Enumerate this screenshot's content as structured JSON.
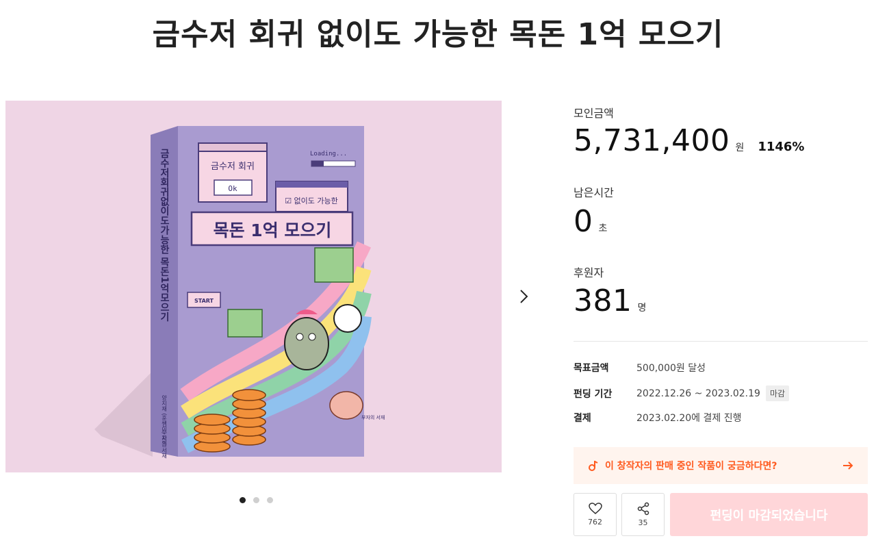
{
  "title": "금수저 회귀 없이도 가능한 목돈 1억 모으기",
  "gallery": {
    "book": {
      "spine_title": "금수저회귀없이도가능한 목돈1억모으기",
      "spine_author": "양지재 (훈쌤이) 지음",
      "spine_publisher": "부자의 서재",
      "popup1_title": "금수저 회귀",
      "popup1_button": "Ok",
      "loading_text": "Loading...",
      "popup2_text": "☑ 없이도 가능한",
      "main_title": "목돈 1억 모으기",
      "start_label": "START",
      "pig_text": "부자의 서재"
    },
    "dots_active": 0
  },
  "stats": {
    "raised_label": "모인금액",
    "raised_value": "5,731,400",
    "raised_unit": "원",
    "raised_percent": "1146%",
    "time_label": "남은시간",
    "time_value": "0",
    "time_unit": "초",
    "backers_label": "후원자",
    "backers_value": "381",
    "backers_unit": "명"
  },
  "info": {
    "goal_key": "목표금액",
    "goal_value": "500,000원 달성",
    "period_key": "펀딩 기간",
    "period_value": "2022.12.26 ~ 2023.02.19",
    "period_badge": "마감",
    "payment_key": "결제",
    "payment_value": "2023.02.20에 결제 진행"
  },
  "promo": {
    "text": "이 창작자의 판매 중인 작품이 궁금하다면?"
  },
  "actions": {
    "like_count": "762",
    "share_count": "35",
    "closed_label": "펀딩이 마감되었습니다"
  },
  "colors": {
    "accent": "#ff5a1f",
    "closed_bg": "#ffd6d9",
    "promo_bg": "#fff4ee",
    "gallery_bg": "#efd5e5",
    "book": "#a99bd0"
  },
  "icons": [
    "chevron-right-icon",
    "note-icon",
    "arrow-right-icon",
    "heart-icon",
    "share-icon"
  ]
}
